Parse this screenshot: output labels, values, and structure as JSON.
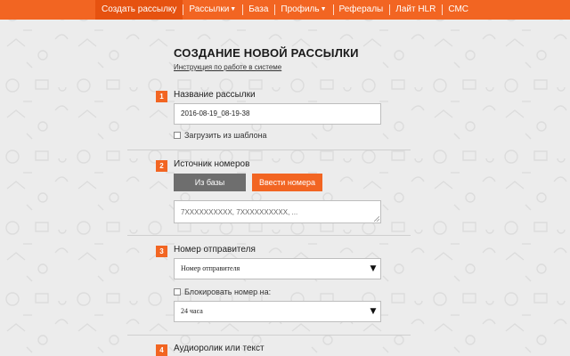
{
  "nav": {
    "items": [
      {
        "label": "Создать рассылку",
        "active": true,
        "dropdown": false
      },
      {
        "label": "Рассылки",
        "active": false,
        "dropdown": true
      },
      {
        "label": "База",
        "active": false,
        "dropdown": false
      },
      {
        "label": "Профиль",
        "active": false,
        "dropdown": true
      },
      {
        "label": "Рефералы",
        "active": false,
        "dropdown": false
      },
      {
        "label": "Лайт HLR",
        "active": false,
        "dropdown": false
      },
      {
        "label": "СМС",
        "active": false,
        "dropdown": false
      }
    ]
  },
  "page": {
    "title": "СОЗДАНИЕ НОВОЙ РАССЫЛКИ",
    "help_link": "Инструкция по работе в системе"
  },
  "steps": {
    "s1": {
      "num": "1",
      "label": "Название рассылки",
      "input_value": "2016-08-19_08-19-38",
      "checkbox_label": "Загрузить из шаблона"
    },
    "s2": {
      "num": "2",
      "label": "Источник номеров",
      "btn_from_db": "Из базы",
      "btn_enter": "Ввести номера",
      "textarea_placeholder": "7XXXXXXXXXX, 7XXXXXXXXXX, ..."
    },
    "s3": {
      "num": "3",
      "label": "Номер отправителя",
      "sender_select": "Номер отправителя",
      "block_checkbox_label": "Блокировать номер на:",
      "block_select": "24 часа"
    },
    "s4": {
      "num": "4",
      "label": "Аудиоролик или текст"
    }
  },
  "colors": {
    "accent": "#f26522",
    "button_gray": "#6e6e6e",
    "background": "#ececec"
  },
  "icons": {
    "select_arrow": "triangle-down-icon"
  }
}
